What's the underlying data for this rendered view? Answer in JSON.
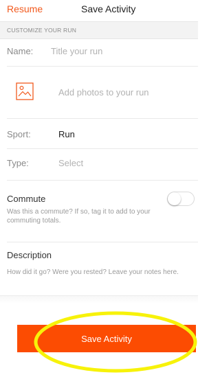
{
  "header": {
    "resume_label": "Resume",
    "title": "Save Activity"
  },
  "section": {
    "title": "CUSTOMIZE YOUR RUN"
  },
  "form": {
    "name_label": "Name:",
    "name_placeholder": "Title your run",
    "photos_label": "Add photos to your run",
    "sport_label": "Sport:",
    "sport_value": "Run",
    "type_label": "Type:",
    "type_placeholder": "Select",
    "commute_label": "Commute",
    "commute_desc": "Was this a commute? If so, tag it to add to your commuting totals.",
    "commute_enabled": false,
    "description_label": "Description",
    "description_placeholder": "How did it go? Were you rested? Leave your notes here."
  },
  "footer": {
    "save_label": "Save Activity"
  },
  "colors": {
    "accent": "#fc4c02",
    "link": "#f25a1e",
    "highlight": "#f7f20a"
  },
  "icons": {
    "photo": "photo-icon"
  }
}
